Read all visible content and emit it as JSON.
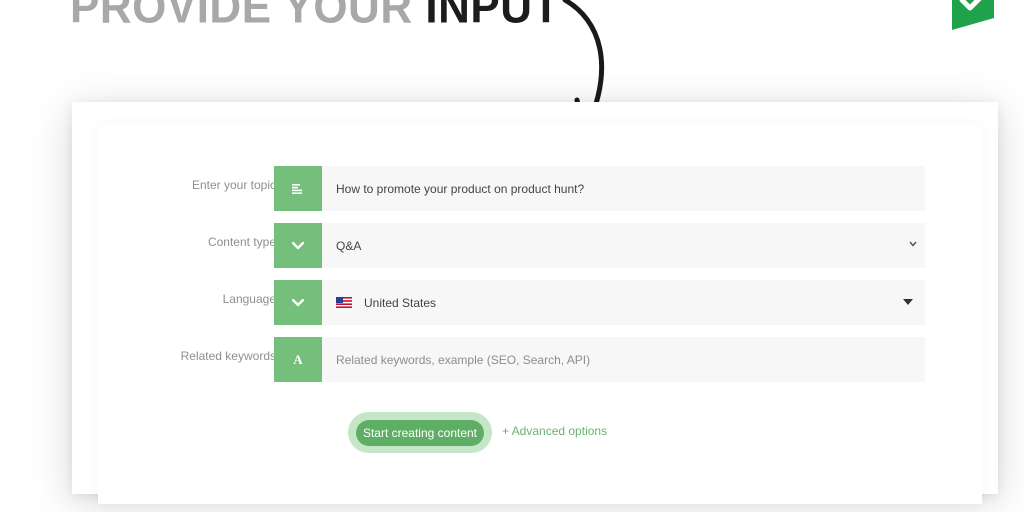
{
  "headline": {
    "muted": "PROVIDE YOUR",
    "strong": "INPUT"
  },
  "icons": {
    "logo": "green-check-badge-icon",
    "arrow": "curved-arrow-down-icon",
    "topic": "text-lines-icon",
    "content_type": "chevron-down-icon",
    "language": "chevron-down-icon",
    "keywords": "letter-a-icon",
    "flag": "us-flag-icon"
  },
  "colors": {
    "accent": "#74bf7b",
    "button": "#5fae66",
    "link": "#6ab372"
  },
  "form": {
    "topic": {
      "label": "Enter your topic",
      "value": "How to promote your product on product hunt?"
    },
    "content_type": {
      "label": "Content type",
      "value": "Q&A"
    },
    "language": {
      "label": "Language",
      "value": "United States"
    },
    "keywords": {
      "label": "Related keywords",
      "placeholder": "Related keywords, example (SEO, Search, API)",
      "icon_letter": "A"
    }
  },
  "actions": {
    "start": "Start creating content",
    "advanced": "+ Advanced options"
  }
}
